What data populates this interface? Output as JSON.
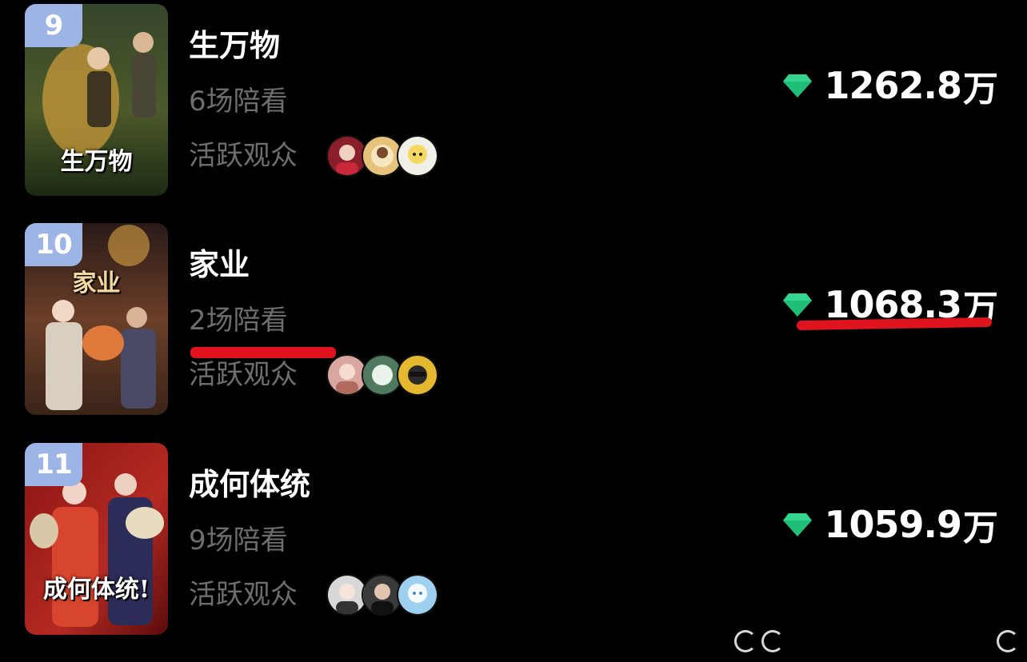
{
  "rows": [
    {
      "rank": "9",
      "poster_title": "生万物",
      "title": "生万物",
      "companions": "6场陪看",
      "audience_label": "活跃观众",
      "score_value": "1262.8",
      "score_unit": "万",
      "poster_colors": [
        "#1f3a1c",
        "#5c6b2f",
        "#d2a64a"
      ],
      "avatar_colors": [
        "#8a1e2a",
        "#e6c27a",
        "#f0f0e8"
      ],
      "avatar_icons": [
        "user-avatar-icon",
        "user-avatar-icon",
        "user-avatar-icon"
      ]
    },
    {
      "rank": "10",
      "poster_title": "家业",
      "title": "家业",
      "companions": "2场陪看",
      "audience_label": "活跃观众",
      "score_value": "1068.3",
      "score_unit": "万",
      "poster_colors": [
        "#2b1d18",
        "#7a4a2e",
        "#e0a066"
      ],
      "avatar_colors": [
        "#d9a7a0",
        "#7fa68a",
        "#e6b830"
      ],
      "avatar_icons": [
        "user-avatar-icon",
        "user-avatar-icon",
        "user-avatar-icon"
      ]
    },
    {
      "rank": "11",
      "poster_title": "成何体统!",
      "title": "成何体统",
      "companions": "9场陪看",
      "audience_label": "活跃观众",
      "score_value": "1059.9",
      "score_unit": "万",
      "poster_colors": [
        "#7a0f12",
        "#c2362b",
        "#2a2a55"
      ],
      "avatar_colors": [
        "#d8d8d8",
        "#3a3a3a",
        "#9fd0ef"
      ],
      "avatar_icons": [
        "user-avatar-icon",
        "user-avatar-icon",
        "user-avatar-icon"
      ]
    }
  ],
  "gem_color": "#1fbf7a",
  "highlight_color": "#e0141e",
  "badge_color": "#9cb4e6"
}
